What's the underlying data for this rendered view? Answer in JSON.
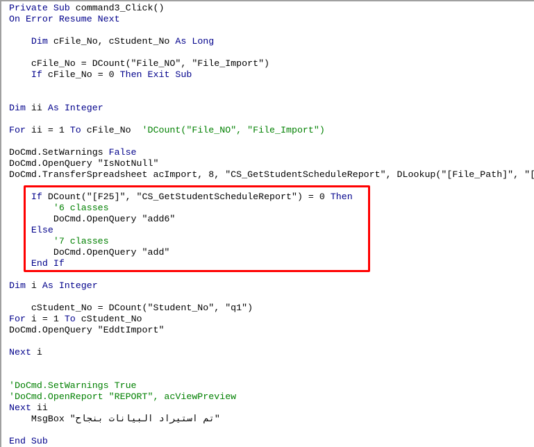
{
  "editor": {
    "highlight_color": "#ff0000",
    "colors": {
      "keyword": "#00008b",
      "comment": "#008000",
      "text": "#000000"
    },
    "lines": [
      [
        [
          "kw",
          "Private Sub "
        ],
        [
          "tx",
          "command3_Click()"
        ]
      ],
      [
        [
          "kw",
          "On Error Resume Next"
        ]
      ],
      [],
      [
        [
          "tx",
          "    "
        ],
        [
          "kw",
          "Dim "
        ],
        [
          "tx",
          "cFile_No, cStudent_No "
        ],
        [
          "kw",
          "As Long"
        ]
      ],
      [],
      [
        [
          "tx",
          "    cFile_No = DCount(\"File_NO\", \"File_Import\")"
        ]
      ],
      [
        [
          "tx",
          "    "
        ],
        [
          "kw",
          "If "
        ],
        [
          "tx",
          "cFile_No = 0 "
        ],
        [
          "kw",
          "Then Exit Sub"
        ]
      ],
      [],
      [],
      [
        [
          "kw",
          "Dim "
        ],
        [
          "tx",
          "ii "
        ],
        [
          "kw",
          "As Integer"
        ]
      ],
      [],
      [
        [
          "kw",
          "For "
        ],
        [
          "tx",
          "ii = 1 "
        ],
        [
          "kw",
          "To "
        ],
        [
          "tx",
          "cFile_No  "
        ],
        [
          "cm",
          "'DCount(\"File_NO\", \"File_Import\")"
        ]
      ],
      [],
      [
        [
          "tx",
          "DoCmd.SetWarnings "
        ],
        [
          "kw",
          "False"
        ]
      ],
      [
        [
          "tx",
          "DoCmd.OpenQuery \"IsNotNull\""
        ]
      ],
      [
        [
          "tx",
          "DoCmd.TransferSpreadsheet acImport, 8, \"CS_GetStudentScheduleReport\", DLookup(\"[File_Path]\", \"["
        ]
      ],
      [],
      [
        [
          "tx",
          "    "
        ],
        [
          "kw",
          "If "
        ],
        [
          "tx",
          "DCount(\"[F25]\", \"CS_GetStudentScheduleReport\") = 0 "
        ],
        [
          "kw",
          "Then"
        ]
      ],
      [
        [
          "tx",
          "        "
        ],
        [
          "cm",
          "'6 classes"
        ]
      ],
      [
        [
          "tx",
          "        DoCmd.OpenQuery \"add6\""
        ]
      ],
      [
        [
          "tx",
          "    "
        ],
        [
          "kw",
          "Else"
        ]
      ],
      [
        [
          "tx",
          "        "
        ],
        [
          "cm",
          "'7 classes"
        ]
      ],
      [
        [
          "tx",
          "        DoCmd.OpenQuery \"add\""
        ]
      ],
      [
        [
          "tx",
          "    "
        ],
        [
          "kw",
          "End If"
        ]
      ],
      [],
      [
        [
          "kw",
          "Dim "
        ],
        [
          "tx",
          "i "
        ],
        [
          "kw",
          "As Integer"
        ]
      ],
      [],
      [
        [
          "tx",
          "    cStudent_No = DCount(\"Student_No\", \"q1\")"
        ]
      ],
      [
        [
          "kw",
          "For "
        ],
        [
          "tx",
          "i = 1 "
        ],
        [
          "kw",
          "To "
        ],
        [
          "tx",
          "cStudent_No"
        ]
      ],
      [
        [
          "tx",
          "DoCmd.OpenQuery \"EddtImport\""
        ]
      ],
      [],
      [
        [
          "kw",
          "Next "
        ],
        [
          "tx",
          "i"
        ]
      ],
      [],
      [],
      [
        [
          "cm",
          "'DoCmd.SetWarnings True"
        ]
      ],
      [
        [
          "cm",
          "'DoCmd.OpenReport \"REPORT\", acViewPreview"
        ]
      ],
      [
        [
          "kw",
          "Next "
        ],
        [
          "tx",
          "ii"
        ]
      ],
      [
        [
          "tx",
          "    MsgBox \"تم استيراد البيانات بنجاح\""
        ]
      ],
      [],
      [
        [
          "kw",
          "End Sub"
        ]
      ]
    ]
  }
}
